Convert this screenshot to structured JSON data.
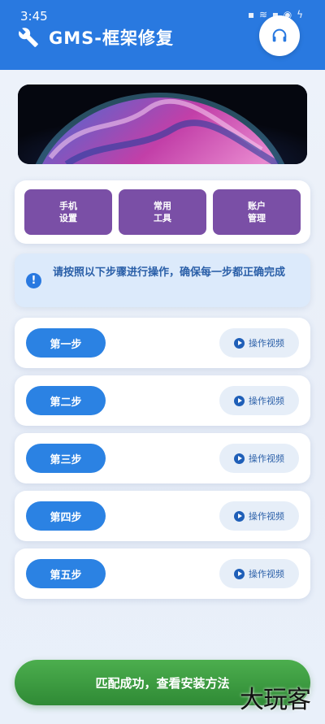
{
  "status_bar": {
    "time": "3:45",
    "icons": "▪ ≋ ▪ ◉ ϟ"
  },
  "header": {
    "title": "GMS-框架修复"
  },
  "tools": [
    {
      "label": "手机\n设置"
    },
    {
      "label": "常用\n工具"
    },
    {
      "label": "账户\n管理"
    }
  ],
  "notice": {
    "text": "请按照以下步骤进行操作，确保每一步都正确完成"
  },
  "steps": [
    {
      "label": "第一步",
      "video_label": "操作视频"
    },
    {
      "label": "第二步",
      "video_label": "操作视频"
    },
    {
      "label": "第三步",
      "video_label": "操作视频"
    },
    {
      "label": "第四步",
      "video_label": "操作视频"
    },
    {
      "label": "第五步",
      "video_label": "操作视频"
    }
  ],
  "success_button": {
    "label": "匹配成功，查看安装方法"
  },
  "watermark": {
    "text": "大玩客"
  },
  "colors": {
    "primary": "#2979e0",
    "tool_purple": "#7a4fa6",
    "success_green": "#3c9a40"
  }
}
